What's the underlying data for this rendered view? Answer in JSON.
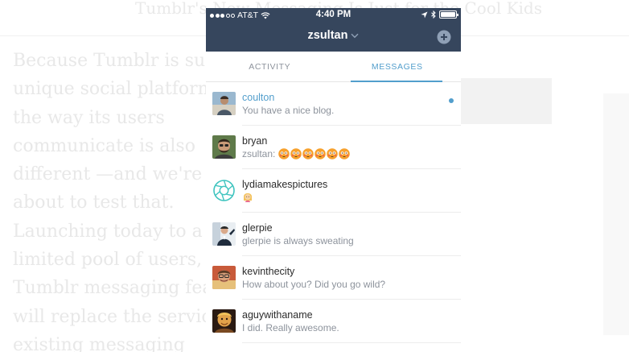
{
  "article": {
    "headline": "Tumblr's New Messaging Is Just for the Cool Kids",
    "body_lines": [
      "Because Tumblr is such a",
      "unique social platform,",
      "the way its users",
      "communicate is also",
      "different —and we're",
      "about to test that.",
      "Launching today to a",
      "limited pool of users,",
      "Tumblr messaging feature",
      "will replace the service's",
      "existing messaging"
    ]
  },
  "status_bar": {
    "carrier": "AT&T",
    "time": "4:40 PM",
    "icons": [
      "signal-dots-icon",
      "wifi-icon",
      "location-arrow-icon",
      "bluetooth-icon",
      "battery-icon"
    ]
  },
  "nav": {
    "account_name": "zsultan",
    "icons": [
      "chevron-down-icon",
      "compose-icon"
    ]
  },
  "tabs": {
    "activity": "ACTIVITY",
    "messages": "MESSAGES",
    "active": "messages"
  },
  "colors": {
    "header": "#36465d",
    "accent": "#529ecc",
    "muted_text": "#8d939c"
  },
  "conversations": [
    {
      "name": "coulton",
      "snippet": "You have a nice blog.",
      "unread": true
    },
    {
      "name": "bryan",
      "snippet_prefix": "zsultan:",
      "snippet_emoji": "flushed-face-emoji x6"
    },
    {
      "name": "lydiamakespictures",
      "snippet_emoji": "person-emoji"
    },
    {
      "name": "glerpie",
      "snippet": "glerpie is always sweating"
    },
    {
      "name": "kevinthecity",
      "snippet": "How about you? Did you go wild?"
    },
    {
      "name": "aguywithaname",
      "snippet": "I did. Really awesome."
    }
  ]
}
